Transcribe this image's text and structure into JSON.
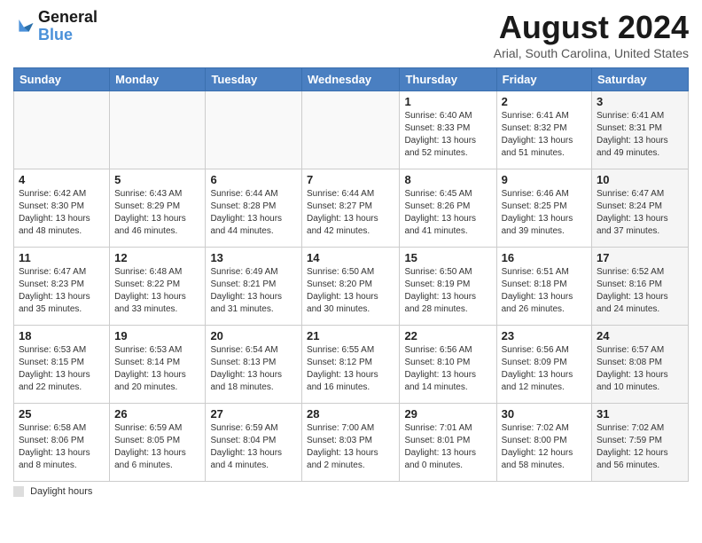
{
  "header": {
    "logo_line1": "General",
    "logo_line2": "Blue",
    "main_title": "August 2024",
    "subtitle": "Arial, South Carolina, United States"
  },
  "days_of_week": [
    "Sunday",
    "Monday",
    "Tuesday",
    "Wednesday",
    "Thursday",
    "Friday",
    "Saturday"
  ],
  "weeks": [
    [
      {
        "day": "",
        "info": ""
      },
      {
        "day": "",
        "info": ""
      },
      {
        "day": "",
        "info": ""
      },
      {
        "day": "",
        "info": ""
      },
      {
        "day": "1",
        "info": "Sunrise: 6:40 AM\nSunset: 8:33 PM\nDaylight: 13 hours and 52 minutes."
      },
      {
        "day": "2",
        "info": "Sunrise: 6:41 AM\nSunset: 8:32 PM\nDaylight: 13 hours and 51 minutes."
      },
      {
        "day": "3",
        "info": "Sunrise: 6:41 AM\nSunset: 8:31 PM\nDaylight: 13 hours and 49 minutes."
      }
    ],
    [
      {
        "day": "4",
        "info": "Sunrise: 6:42 AM\nSunset: 8:30 PM\nDaylight: 13 hours and 48 minutes."
      },
      {
        "day": "5",
        "info": "Sunrise: 6:43 AM\nSunset: 8:29 PM\nDaylight: 13 hours and 46 minutes."
      },
      {
        "day": "6",
        "info": "Sunrise: 6:44 AM\nSunset: 8:28 PM\nDaylight: 13 hours and 44 minutes."
      },
      {
        "day": "7",
        "info": "Sunrise: 6:44 AM\nSunset: 8:27 PM\nDaylight: 13 hours and 42 minutes."
      },
      {
        "day": "8",
        "info": "Sunrise: 6:45 AM\nSunset: 8:26 PM\nDaylight: 13 hours and 41 minutes."
      },
      {
        "day": "9",
        "info": "Sunrise: 6:46 AM\nSunset: 8:25 PM\nDaylight: 13 hours and 39 minutes."
      },
      {
        "day": "10",
        "info": "Sunrise: 6:47 AM\nSunset: 8:24 PM\nDaylight: 13 hours and 37 minutes."
      }
    ],
    [
      {
        "day": "11",
        "info": "Sunrise: 6:47 AM\nSunset: 8:23 PM\nDaylight: 13 hours and 35 minutes."
      },
      {
        "day": "12",
        "info": "Sunrise: 6:48 AM\nSunset: 8:22 PM\nDaylight: 13 hours and 33 minutes."
      },
      {
        "day": "13",
        "info": "Sunrise: 6:49 AM\nSunset: 8:21 PM\nDaylight: 13 hours and 31 minutes."
      },
      {
        "day": "14",
        "info": "Sunrise: 6:50 AM\nSunset: 8:20 PM\nDaylight: 13 hours and 30 minutes."
      },
      {
        "day": "15",
        "info": "Sunrise: 6:50 AM\nSunset: 8:19 PM\nDaylight: 13 hours and 28 minutes."
      },
      {
        "day": "16",
        "info": "Sunrise: 6:51 AM\nSunset: 8:18 PM\nDaylight: 13 hours and 26 minutes."
      },
      {
        "day": "17",
        "info": "Sunrise: 6:52 AM\nSunset: 8:16 PM\nDaylight: 13 hours and 24 minutes."
      }
    ],
    [
      {
        "day": "18",
        "info": "Sunrise: 6:53 AM\nSunset: 8:15 PM\nDaylight: 13 hours and 22 minutes."
      },
      {
        "day": "19",
        "info": "Sunrise: 6:53 AM\nSunset: 8:14 PM\nDaylight: 13 hours and 20 minutes."
      },
      {
        "day": "20",
        "info": "Sunrise: 6:54 AM\nSunset: 8:13 PM\nDaylight: 13 hours and 18 minutes."
      },
      {
        "day": "21",
        "info": "Sunrise: 6:55 AM\nSunset: 8:12 PM\nDaylight: 13 hours and 16 minutes."
      },
      {
        "day": "22",
        "info": "Sunrise: 6:56 AM\nSunset: 8:10 PM\nDaylight: 13 hours and 14 minutes."
      },
      {
        "day": "23",
        "info": "Sunrise: 6:56 AM\nSunset: 8:09 PM\nDaylight: 13 hours and 12 minutes."
      },
      {
        "day": "24",
        "info": "Sunrise: 6:57 AM\nSunset: 8:08 PM\nDaylight: 13 hours and 10 minutes."
      }
    ],
    [
      {
        "day": "25",
        "info": "Sunrise: 6:58 AM\nSunset: 8:06 PM\nDaylight: 13 hours and 8 minutes."
      },
      {
        "day": "26",
        "info": "Sunrise: 6:59 AM\nSunset: 8:05 PM\nDaylight: 13 hours and 6 minutes."
      },
      {
        "day": "27",
        "info": "Sunrise: 6:59 AM\nSunset: 8:04 PM\nDaylight: 13 hours and 4 minutes."
      },
      {
        "day": "28",
        "info": "Sunrise: 7:00 AM\nSunset: 8:03 PM\nDaylight: 13 hours and 2 minutes."
      },
      {
        "day": "29",
        "info": "Sunrise: 7:01 AM\nSunset: 8:01 PM\nDaylight: 13 hours and 0 minutes."
      },
      {
        "day": "30",
        "info": "Sunrise: 7:02 AM\nSunset: 8:00 PM\nDaylight: 12 hours and 58 minutes."
      },
      {
        "day": "31",
        "info": "Sunrise: 7:02 AM\nSunset: 7:59 PM\nDaylight: 12 hours and 56 minutes."
      }
    ]
  ],
  "footer": {
    "label": "Daylight hours"
  }
}
